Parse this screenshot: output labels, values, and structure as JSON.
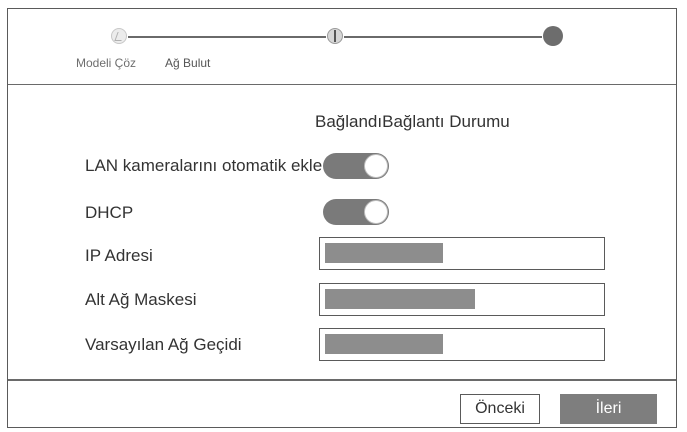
{
  "steps": [
    {
      "label": "Modeli Çöz",
      "icon": "wizard-step-icon"
    },
    {
      "label": "Ağ Bulut",
      "icon": "network-step-icon"
    },
    {
      "label": "",
      "icon": "cloud-step-icon"
    }
  ],
  "content": {
    "title": "BağlandıBağlantı Durumu",
    "lan_auto_add": {
      "label": "LAN kameralarını otomatik ekle",
      "enabled": true
    },
    "dhcp": {
      "label": "DHCP",
      "enabled": true
    },
    "ip_address": {
      "label": "IP Adresi",
      "value_masked": true
    },
    "subnet_mask": {
      "label": "Alt Ağ Maskesi",
      "value_masked": true
    },
    "default_gateway": {
      "label": "Varsayılan Ağ Geçidi",
      "value_masked": true
    }
  },
  "footer": {
    "back_label": "Önceki",
    "next_label": "İleri"
  },
  "colors": {
    "toggle_on": "#7a7a7a",
    "primary_button": "#7e7e7e",
    "border": "#5a5a5a"
  }
}
